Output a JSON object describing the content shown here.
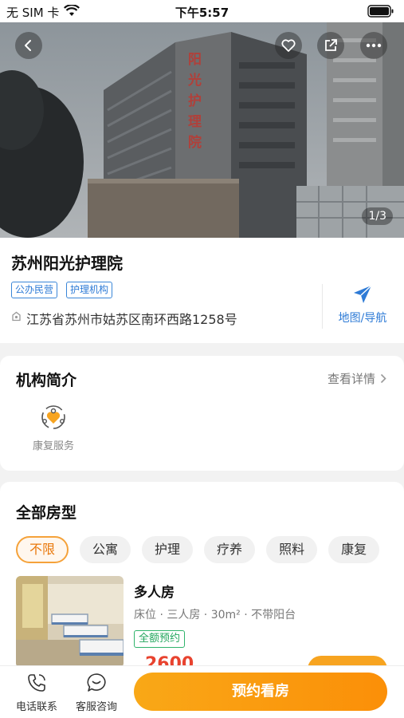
{
  "status_bar": {
    "carrier": "无 SIM 卡",
    "time": "下午5:57"
  },
  "hero": {
    "counter": "1/3",
    "building_sign": "阳光护理院"
  },
  "facility": {
    "name": "苏州阳光护理院",
    "tags": [
      "公办民营",
      "护理机构"
    ],
    "address": "江苏省苏州市姑苏区南环西路1258号",
    "map_label": "地图/导航"
  },
  "intro": {
    "title": "机构简介",
    "more": "查看详情",
    "services": [
      {
        "label": "康复服务",
        "icon": "rehab-icon"
      }
    ]
  },
  "rooms": {
    "title": "全部房型",
    "filters": [
      "不限",
      "公寓",
      "护理",
      "疗养",
      "照料",
      "康复"
    ],
    "selected_filter": "不限",
    "items": [
      {
        "name": "多人房",
        "desc": "床位 · 三人房 · 30m² · 不带阳台",
        "tag": "全额预约",
        "price": "2600"
      }
    ]
  },
  "bottom_bar": {
    "phone_label": "电话联系",
    "chat_label": "客服咨询",
    "book_label": "预约看房"
  },
  "colors": {
    "accent": "#f7a420",
    "link_blue": "#2e7bd6",
    "tag_green": "#22a65d",
    "price_red": "#e8432f"
  }
}
